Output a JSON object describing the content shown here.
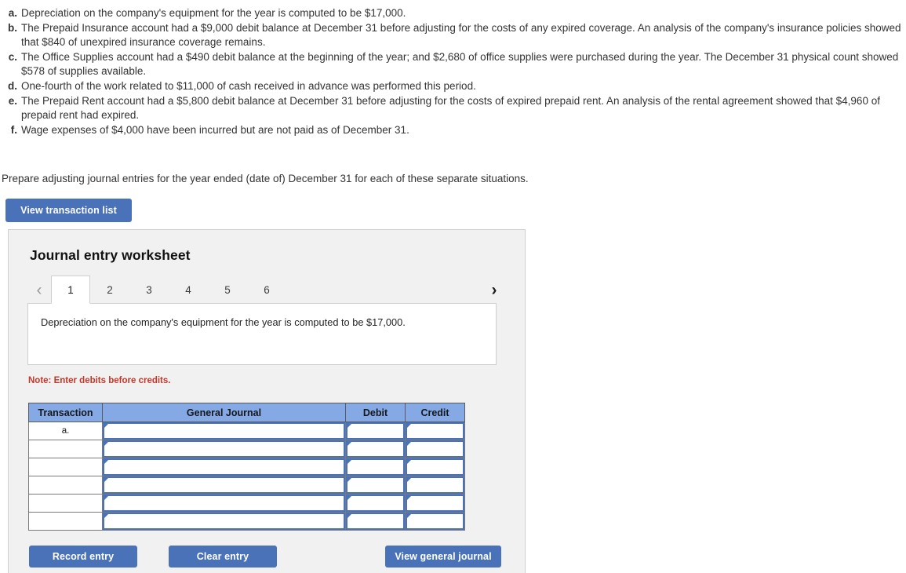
{
  "problem": {
    "items": [
      {
        "letter": "a.",
        "text": "Depreciation on the company's equipment for the year is computed to be $17,000."
      },
      {
        "letter": "b.",
        "text": "The Prepaid Insurance account had a $9,000 debit balance at December 31 before adjusting for the costs of any expired coverage. An analysis of the company's insurance policies showed that $840 of unexpired insurance coverage remains."
      },
      {
        "letter": "c.",
        "text": "The Office Supplies account had a $490 debit balance at the beginning of the year; and $2,680 of office supplies were purchased during the year. The December 31 physical count showed $578 of supplies available."
      },
      {
        "letter": "d.",
        "text": "One-fourth of the work related to $11,000 of cash received in advance was performed this period."
      },
      {
        "letter": "e.",
        "text": "The Prepaid Rent account had a $5,800 debit balance at December 31 before adjusting for the costs of expired prepaid rent. An analysis of the rental agreement showed that $4,960 of prepaid rent had expired."
      },
      {
        "letter": "f.",
        "text": "Wage expenses of $4,000 have been incurred but are not paid as of December 31."
      }
    ],
    "prompt": "Prepare adjusting journal entries for the year ended (date of) December 31 for each of these separate situations."
  },
  "toolbar": {
    "view_transaction_list_label": "View transaction list"
  },
  "worksheet": {
    "title": "Journal entry worksheet",
    "tabs": [
      "1",
      "2",
      "3",
      "4",
      "5",
      "6"
    ],
    "active_tab": "1",
    "prev_arrow": "‹",
    "next_arrow": "›",
    "description": "Depreciation on the company's equipment for the year is computed to be $17,000.",
    "note": "Note: Enter debits before credits.",
    "table": {
      "columns": [
        "Transaction",
        "General Journal",
        "Debit",
        "Credit"
      ],
      "rows": [
        {
          "transaction": "a.",
          "general_journal": "",
          "debit": "",
          "credit": ""
        },
        {
          "transaction": "",
          "general_journal": "",
          "debit": "",
          "credit": ""
        },
        {
          "transaction": "",
          "general_journal": "",
          "debit": "",
          "credit": ""
        },
        {
          "transaction": "",
          "general_journal": "",
          "debit": "",
          "credit": ""
        },
        {
          "transaction": "",
          "general_journal": "",
          "debit": "",
          "credit": ""
        },
        {
          "transaction": "",
          "general_journal": "",
          "debit": "",
          "credit": ""
        }
      ]
    },
    "actions": {
      "record_label": "Record entry",
      "clear_label": "Clear entry",
      "view_journal_label": "View general journal"
    }
  },
  "colors": {
    "button_blue": "#4a72b8",
    "header_blue": "#85a9e5",
    "note_red": "#c1392b",
    "panel_gray": "#f1f1f1"
  }
}
